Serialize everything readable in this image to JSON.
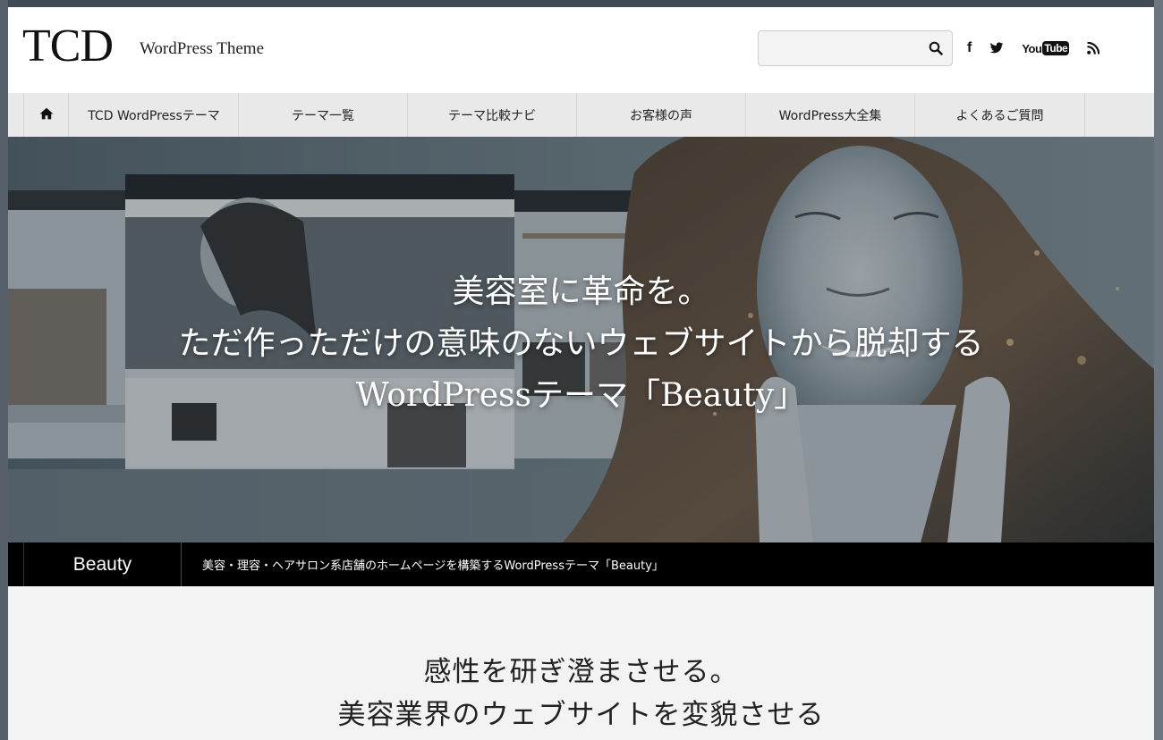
{
  "header": {
    "logo": "TCD",
    "logo_subtitle": "WordPress Theme",
    "search": {
      "value": "",
      "placeholder": ""
    },
    "social": [
      "facebook-icon",
      "twitter-icon",
      "youtube-icon",
      "rss-icon"
    ],
    "youtube_you": "You",
    "youtube_tube": "Tube"
  },
  "nav": {
    "items": [
      {
        "label": "TCD WordPressテーマ"
      },
      {
        "label": "テーマ一覧"
      },
      {
        "label": "テーマ比較ナビ"
      },
      {
        "label": "お客様の声"
      },
      {
        "label": "WordPress大全集"
      },
      {
        "label": "よくあるご質問"
      }
    ]
  },
  "hero": {
    "line1": "美容室に革命を。",
    "line2": "ただ作っただけの意味のないウェブサイトから脱却する",
    "line3": "WordPressテーマ「Beauty」"
  },
  "theme_bar": {
    "name": "Beauty",
    "description": "美容・理容・ヘアサロン系店舗のホームページを構築するWordPressテーマ「Beauty」"
  },
  "lower": {
    "line1": "感性を研ぎ澄まさせる。",
    "line2": "美容業界のウェブサイトを変貌させる"
  },
  "colors": {
    "nav_bg": "#e9e9e9",
    "theme_bar_bg": "#000000",
    "hero_tint": "#5c6a73"
  }
}
